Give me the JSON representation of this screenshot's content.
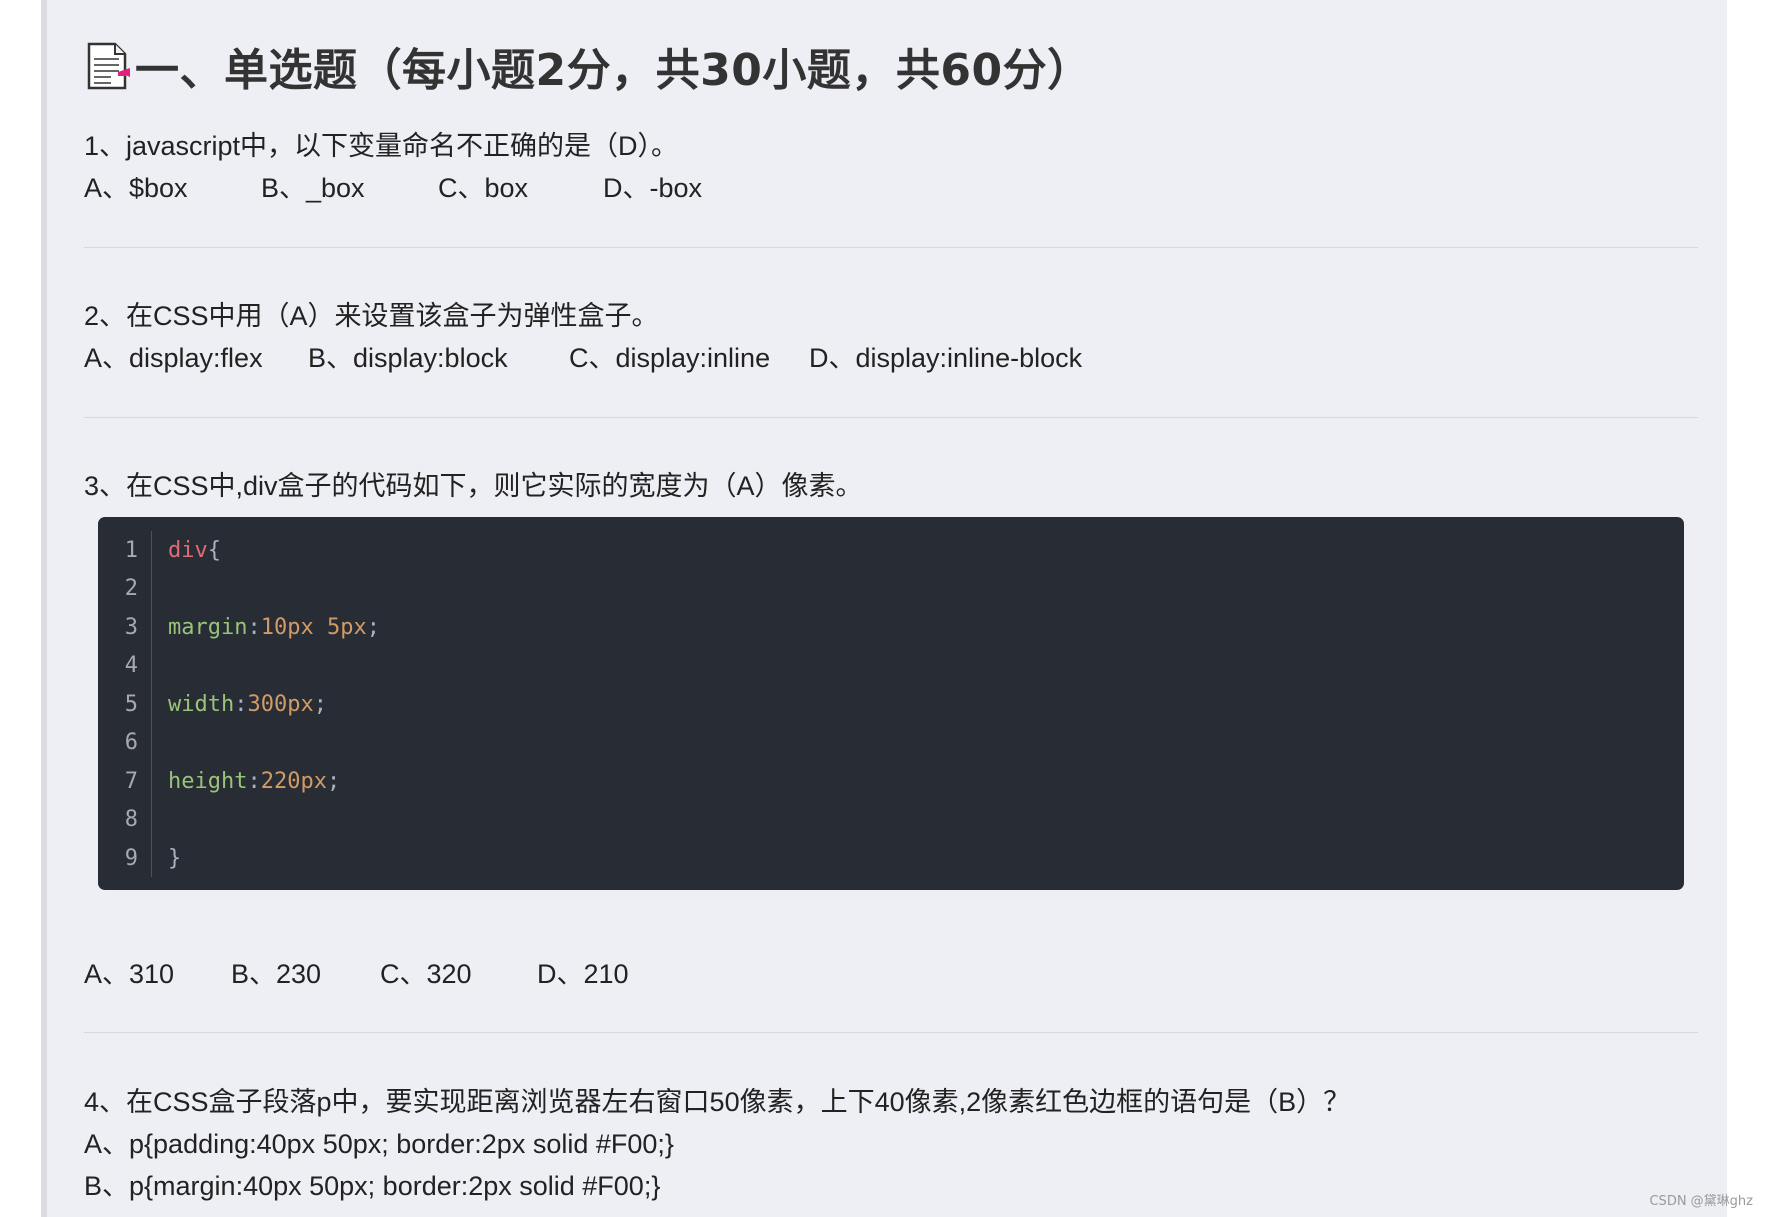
{
  "section": {
    "icon": "document-note-icon",
    "title": "一、单选题（每小题2分，共30小题，共60分）"
  },
  "questions": [
    {
      "stem": "1、javascript中，以下变量命名不正确的是（D）。",
      "options": [
        "A、$box",
        "B、_box",
        "C、box",
        "D、-box"
      ]
    },
    {
      "stem": "2、在CSS中用（A）来设置该盒子为弹性盒子。",
      "options": [
        "A、display:flex",
        "B、display:block",
        "C、display:inline",
        "D、display:inline-block"
      ]
    },
    {
      "stem": "3、在CSS中,div盒子的代码如下，则它实际的宽度为（A）像素。",
      "code": {
        "line_numbers": [
          "1",
          "2",
          "3",
          "4",
          "5",
          "6",
          "7",
          "8",
          "9"
        ],
        "lines": [
          {
            "selector": "div",
            "punc": "{"
          },
          {},
          {
            "prop": "margin",
            "colon": ":",
            "value": "10px 5px",
            "end": ";"
          },
          {},
          {
            "prop": "width",
            "colon": ":",
            "value": "300px",
            "end": ";"
          },
          {},
          {
            "prop": "height",
            "colon": ":",
            "value": "220px",
            "end": ";"
          },
          {},
          {
            "punc": "}"
          }
        ]
      },
      "options": [
        "A、310",
        "B、230",
        "C、320",
        "D、210"
      ]
    },
    {
      "stem": "4、在CSS盒子段落p中，要实现距离浏览器左右窗口50像素，上下40像素,2像素红色边框的语句是（B）？",
      "options": [
        "A、p{padding:40px 50px;  border:2px solid #F00;}",
        "B、p{margin:40px 50px;  border:2px solid #F00;}"
      ]
    }
  ],
  "watermark": "CSDN @黛琳ghz",
  "colors": {
    "panel_bg": "#eeeff4",
    "code_bg": "#282c34",
    "selector": "#e06c75",
    "property": "#98c379",
    "number": "#d19a66"
  }
}
